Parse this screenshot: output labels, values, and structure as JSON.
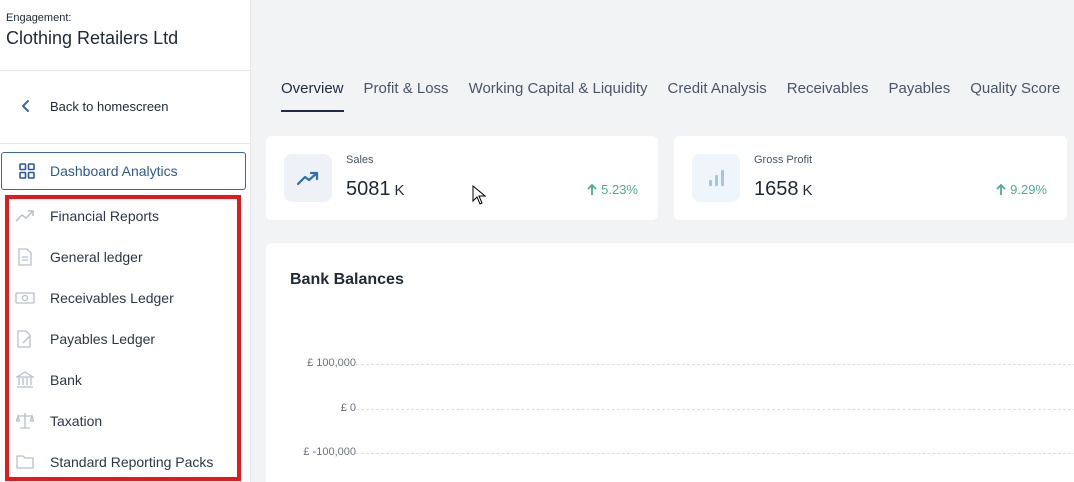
{
  "engagement": {
    "label": "Engagement:",
    "name": "Clothing Retailers Ltd"
  },
  "back": {
    "label": "Back to homescreen",
    "icon": "chevron-left-icon"
  },
  "dashboard": {
    "label": "Dashboard Analytics",
    "icon": "grid-icon",
    "accent": "#2a5a9a"
  },
  "highlight_color": "#e8181a",
  "nav": [
    {
      "label": "Financial Reports",
      "icon": "trend-icon"
    },
    {
      "label": "General ledger",
      "icon": "document-icon"
    },
    {
      "label": "Receivables Ledger",
      "icon": "money-icon"
    },
    {
      "label": "Payables Ledger",
      "icon": "edit-document-icon"
    },
    {
      "label": "Bank",
      "icon": "bank-icon"
    },
    {
      "label": "Taxation",
      "icon": "scales-icon"
    },
    {
      "label": "Standard Reporting Packs",
      "icon": "folder-icon"
    }
  ],
  "tabs": [
    {
      "label": "Overview",
      "active": true
    },
    {
      "label": "Profit & Loss"
    },
    {
      "label": "Working Capital & Liquidity"
    },
    {
      "label": "Credit Analysis"
    },
    {
      "label": "Receivables"
    },
    {
      "label": "Payables"
    },
    {
      "label": "Quality Score"
    }
  ],
  "kpis": [
    {
      "label": "Sales",
      "value": "5081",
      "unit": "K",
      "change": "5.23%",
      "icon": "trend-up-icon"
    },
    {
      "label": "Gross Profit",
      "value": "1658",
      "unit": "K",
      "change": "9.29%",
      "icon": "bar-chart-icon"
    }
  ],
  "bank_balances": {
    "title": "Bank Balances",
    "y_ticks": [
      "£ 100,000",
      "£ 0",
      "£ -100,000"
    ]
  }
}
